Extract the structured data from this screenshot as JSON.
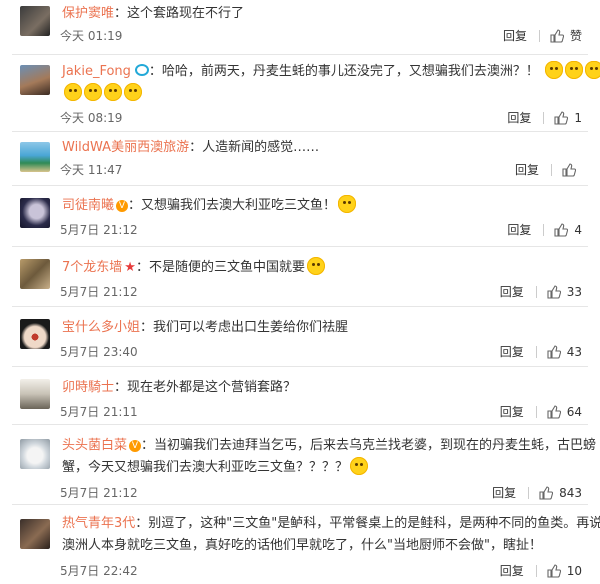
{
  "comments": [
    {
      "user": "保护窦唯",
      "badge": "",
      "colon": "：",
      "text": "这个套路现在不行了",
      "time": "今天 01:19",
      "reply": "回复",
      "like_label": "赞",
      "like_count": "",
      "emojis": 0
    },
    {
      "user": "Jakie_Fong",
      "badge": "camera",
      "colon": "：",
      "text": "哈哈，前两天，丹麦生蚝的事儿还没完了，又想骗我们去澳洲？！",
      "text2": "",
      "time": "今天 08:19",
      "reply": "回复",
      "like_label": "",
      "like_count": "1",
      "emojis": 3,
      "emojis_line2": 4
    },
    {
      "user": "WildWA美丽西澳旅游",
      "badge": "",
      "colon": "：",
      "text": "人造新闻的感觉……",
      "time": "今天 11:47",
      "reply": "回复",
      "like_label": "",
      "like_count": "",
      "emojis": 0
    },
    {
      "user": "司徒南曦",
      "badge": "vip",
      "colon": "：",
      "text": "又想骗我们去澳大利亚吃三文鱼！",
      "time": "5月7日 21:12",
      "reply": "回复",
      "like_label": "",
      "like_count": "4",
      "emojis": 1
    },
    {
      "user": "7个龙东墙",
      "badge": "star",
      "colon": "：",
      "text": "不是随便的三文鱼中国就要",
      "time": "5月7日 21:12",
      "reply": "回复",
      "like_label": "",
      "like_count": "33",
      "emojis": 1
    },
    {
      "user": "宝什么多小姐",
      "badge": "",
      "colon": "：",
      "text": "我们可以考虑出口生姜给你们祛腥",
      "time": "5月7日 23:40",
      "reply": "回复",
      "like_label": "",
      "like_count": "43",
      "emojis": 0
    },
    {
      "user": "卯時騎士",
      "badge": "",
      "colon": "：",
      "text": "现在老外都是这个营销套路？",
      "time": "5月7日 21:11",
      "reply": "回复",
      "like_label": "",
      "like_count": "64",
      "emojis": 0
    },
    {
      "user": "头头菌白菜",
      "badge": "vip",
      "colon": "：",
      "text": "当初骗我们去迪拜当乞丐，后来去乌克兰找老婆，到现在的丹麦生蚝，古巴螃",
      "text2": "蟹，今天又想骗我们去澳大利亚吃三文鱼？？？？",
      "time": "5月7日 21:12",
      "reply": "回复",
      "like_label": "",
      "like_count": "843",
      "emojis": 1
    },
    {
      "user": "热气青年3代",
      "badge": "",
      "colon": "：",
      "text": "别逗了，这种\"三文鱼\"是鲈科，平常餐桌上的是鲑科，是两种不同的鱼类。再说了，",
      "text2": "澳洲人本身就吃三文鱼，真好吃的话他们早就吃了，什么\"当地厨师不会做\"，瞎扯！",
      "time": "5月7日 22:42",
      "reply": "回复",
      "like_label": "",
      "like_count": "10",
      "emojis": 0
    }
  ],
  "colors": {
    "username": "#eb7350",
    "text": "#333333",
    "time": "#666666",
    "divider": "#e6e6e6"
  }
}
